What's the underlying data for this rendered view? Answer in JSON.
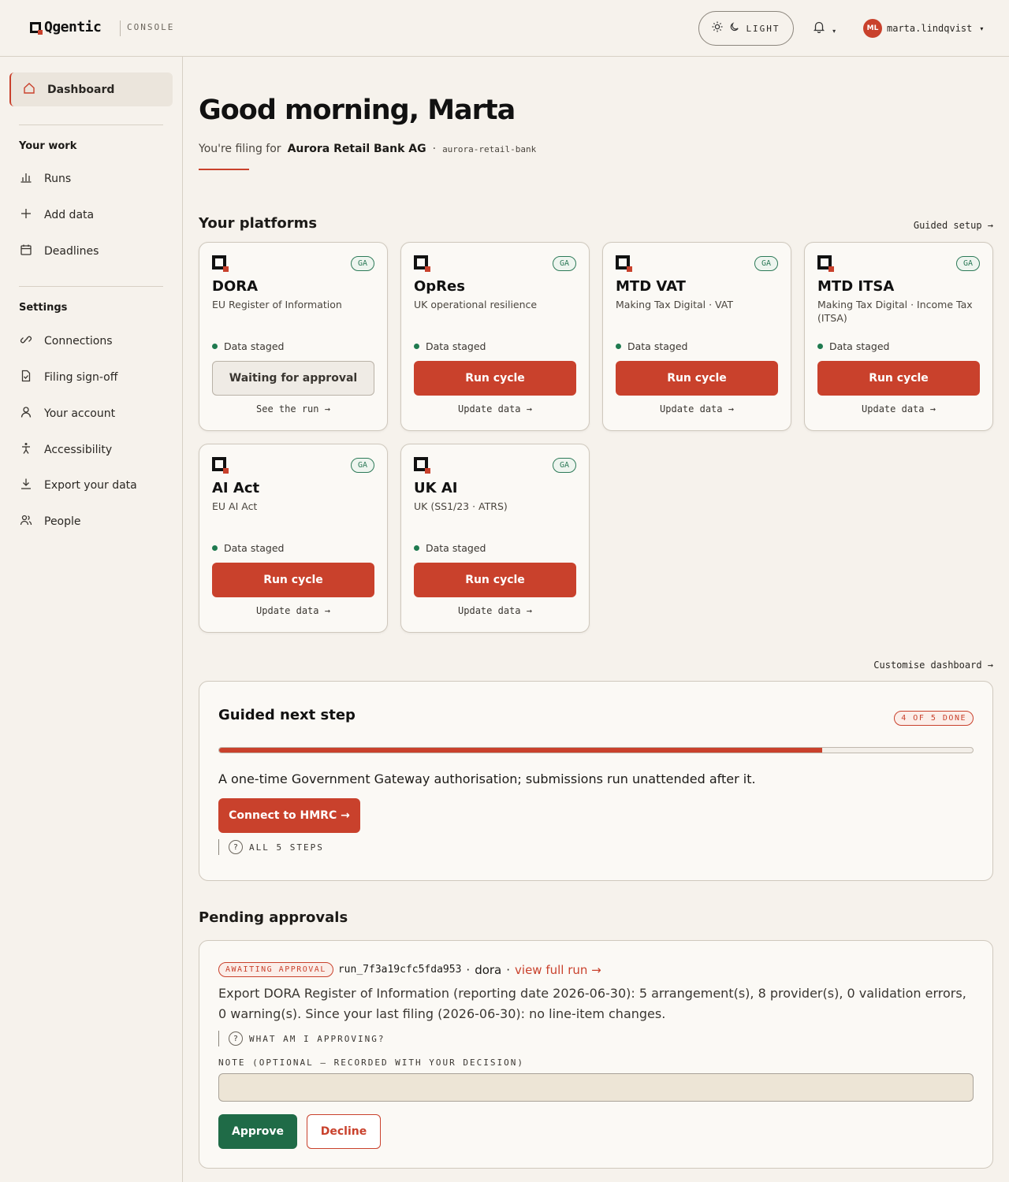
{
  "header": {
    "logo_text": "Qgentic",
    "console_label": "CONSOLE",
    "theme_label": "LIGHT",
    "theme_icons": [
      "sun-icon",
      "moon-icon"
    ],
    "user_initials": "ML",
    "user_name": "marta.lindqvist"
  },
  "sidebar": {
    "active": {
      "label": "Dashboard",
      "icon": "home-icon"
    },
    "work_section": "Your work",
    "work_items": [
      {
        "label": "Runs",
        "icon": "bar-chart-icon"
      },
      {
        "label": "Add data",
        "icon": "plus-icon"
      },
      {
        "label": "Deadlines",
        "icon": "calendar-icon"
      }
    ],
    "settings_section": "Settings",
    "settings_items": [
      {
        "label": "Connections",
        "icon": "link-icon"
      },
      {
        "label": "Filing sign-off",
        "icon": "document-check-icon"
      },
      {
        "label": "Your account",
        "icon": "user-icon"
      },
      {
        "label": "Accessibility",
        "icon": "accessibility-icon"
      },
      {
        "label": "Export your data",
        "icon": "download-icon"
      },
      {
        "label": "People",
        "icon": "people-icon"
      }
    ]
  },
  "greeting": {
    "title": "Good morning, Marta",
    "filing_prefix": "You're filing for",
    "org_name": "Aurora Retail Bank AG",
    "separator": "·",
    "org_slug": "aurora-retail-bank"
  },
  "platforms": {
    "title": "Your platforms",
    "guided_setup_link": "Guided setup →",
    "customise_link": "Customise dashboard →",
    "cards": [
      {
        "name": "DORA",
        "subtitle": "EU Register of Information",
        "badge": "GA",
        "status": "Data staged",
        "button": "Waiting for approval",
        "button_style": "waiting",
        "link": "See the run →"
      },
      {
        "name": "OpRes",
        "subtitle": "UK operational resilience",
        "badge": "GA",
        "status": "Data staged",
        "button": "Run cycle",
        "button_style": "primary",
        "link": "Update data →"
      },
      {
        "name": "MTD VAT",
        "subtitle": "Making Tax Digital · VAT",
        "badge": "GA",
        "status": "Data staged",
        "button": "Run cycle",
        "button_style": "primary",
        "link": "Update data →"
      },
      {
        "name": "MTD ITSA",
        "subtitle": "Making Tax Digital · Income Tax (ITSA)",
        "badge": "GA",
        "status": "Data staged",
        "button": "Run cycle",
        "button_style": "primary",
        "link": "Update data →"
      },
      {
        "name": "AI Act",
        "subtitle": "EU AI Act",
        "badge": "GA",
        "status": "Data staged",
        "button": "Run cycle",
        "button_style": "primary",
        "link": "Update data →"
      },
      {
        "name": "UK AI",
        "subtitle": "UK (SS1/23 · ATRS)",
        "badge": "GA",
        "status": "Data staged",
        "button": "Run cycle",
        "button_style": "primary",
        "link": "Update data →"
      }
    ]
  },
  "guided": {
    "title": "Guided next step",
    "badge": "4 OF 5 DONE",
    "progress_fraction": 0.8,
    "text": "A one-time Government Gateway authorisation; submissions run unattended after it.",
    "button": "Connect to HMRC →",
    "help": "ALL 5 STEPS"
  },
  "approvals": {
    "title": "Pending approvals",
    "badge": "AWAITING APPROVAL",
    "run_id": "run_7f3a19cfc5fda953",
    "sep": "·",
    "platform": "dora",
    "view_link": "view full run →",
    "description": "Export DORA Register of Information (reporting date 2026-06-30): 5 arrangement(s), 8 provider(s), 0 validation errors, 0 warning(s). Since your last filing (2026-06-30): no line-item changes.",
    "help": "WHAT AM I APPROVING?",
    "note_label": "NOTE (OPTIONAL — RECORDED WITH YOUR DECISION)",
    "note_value": "",
    "approve": "Approve",
    "decline": "Decline"
  },
  "colors": {
    "accent": "#c9412c",
    "success": "#1f6b47",
    "background": "#f6f2ec"
  }
}
